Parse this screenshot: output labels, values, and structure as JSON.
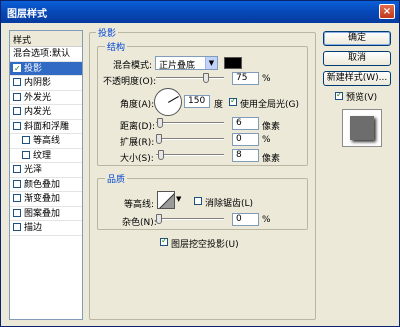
{
  "window": {
    "title": "图层样式",
    "close": "×"
  },
  "sidebar": {
    "header": "样式",
    "items": [
      {
        "label": "混合选项:默认",
        "checkbox": false
      },
      {
        "label": "投影",
        "checkbox": true,
        "checked": true,
        "selected": true
      },
      {
        "label": "内阴影",
        "checkbox": true,
        "checked": false
      },
      {
        "label": "外发光",
        "checkbox": true,
        "checked": false
      },
      {
        "label": "内发光",
        "checkbox": true,
        "checked": false
      },
      {
        "label": "斜面和浮雕",
        "checkbox": true,
        "checked": false
      },
      {
        "label": "等高线",
        "checkbox": true,
        "checked": false,
        "indent": true
      },
      {
        "label": "纹理",
        "checkbox": true,
        "checked": false,
        "indent": true
      },
      {
        "label": "光泽",
        "checkbox": true,
        "checked": false
      },
      {
        "label": "颜色叠加",
        "checkbox": true,
        "checked": false
      },
      {
        "label": "渐变叠加",
        "checkbox": true,
        "checked": false
      },
      {
        "label": "图案叠加",
        "checkbox": true,
        "checked": false
      },
      {
        "label": "描边",
        "checkbox": true,
        "checked": false
      }
    ]
  },
  "panel": {
    "title": "投影",
    "structure": {
      "title": "结构",
      "blend_mode_label": "混合模式:",
      "blend_mode_value": "正片叠底",
      "blend_color": "#000000",
      "opacity_label": "不透明度(O):",
      "opacity_value": "75",
      "opacity_fraction": 0.75,
      "percent": "%",
      "angle_label": "角度(A):",
      "angle_value": "150",
      "degree_unit": "度",
      "global_light_label": "使用全局光(G)",
      "global_light_checked": true,
      "distance_label": "距离(D):",
      "distance_value": "6",
      "spread_label": "扩展(R):",
      "spread_value": "0",
      "size_label": "大小(S):",
      "size_value": "8",
      "pixel_unit": "像素"
    },
    "quality": {
      "title": "品质",
      "contour_label": "等高线:",
      "anti_alias_label": "消除锯齿(L)",
      "anti_alias_checked": false,
      "noise_label": "杂色(N):",
      "noise_value": "0",
      "percent": "%"
    },
    "knockout_label": "图层挖空投影(U)",
    "knockout_checked": true
  },
  "buttons": {
    "ok": "确定",
    "cancel": "取消",
    "new_style": "新建样式(W)...",
    "preview_label": "预览(V)",
    "preview_checked": true
  }
}
